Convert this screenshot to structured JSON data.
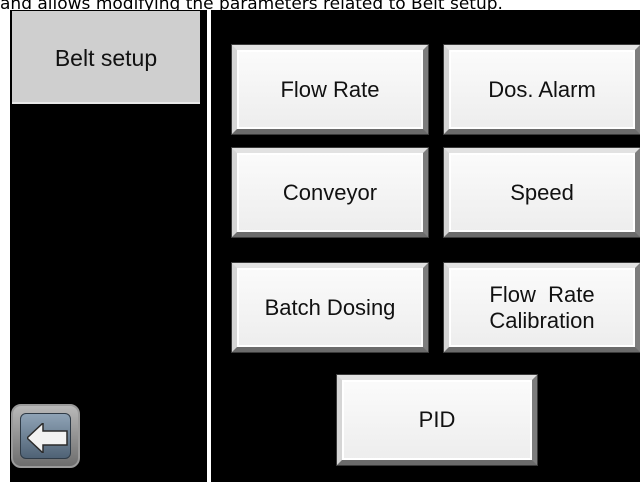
{
  "caption": "and allows modifying the parameters related to Belt setup.",
  "sidebar": {
    "tab_label": "Belt setup"
  },
  "buttons": {
    "flow_rate": "Flow Rate",
    "dos_alarm": "Dos. Alarm",
    "conveyor": "Conveyor",
    "speed": "Speed",
    "batch_dosing": "Batch Dosing",
    "flow_rate_calibration_line1": "Flow  Rate",
    "flow_rate_calibration_line2": "Calibration",
    "pid": "PID"
  },
  "icons": {
    "back": "arrow-left-icon"
  },
  "colors": {
    "screen_bg": "#000000",
    "tab_bg": "#cfcfcf",
    "button_face": "#f3f3f3",
    "back_button": "#5f7388"
  }
}
